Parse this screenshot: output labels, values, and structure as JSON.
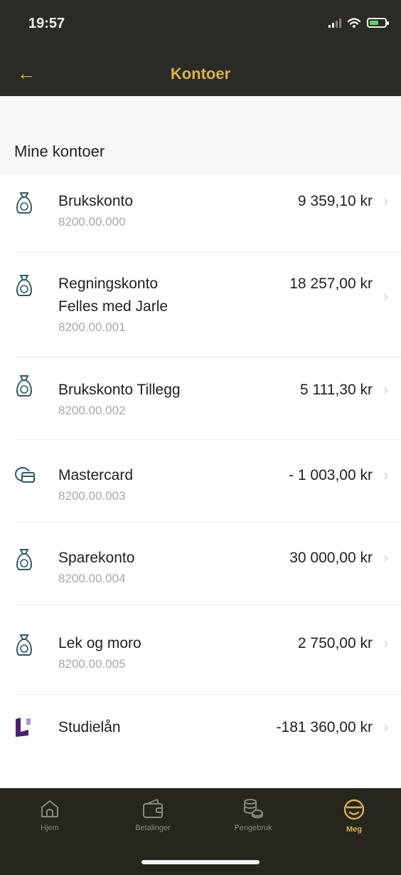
{
  "status_bar": {
    "time": "19:57"
  },
  "header": {
    "title": "Kontoer"
  },
  "section": {
    "title": "Mine kontoer"
  },
  "accounts": [
    {
      "name": "Brukskonto",
      "subname": "",
      "number": "8200.00.000",
      "amount": "9 359,10 kr",
      "icon": "money-bag-icon"
    },
    {
      "name": "Regningskonto",
      "subname": "Felles med Jarle",
      "number": "8200.00.001",
      "amount": "18 257,00 kr",
      "icon": "money-bag-icon"
    },
    {
      "name": "Brukskonto Tillegg",
      "subname": "",
      "number": "8200.00.002",
      "amount": "5 111,30 kr",
      "icon": "money-bag-icon"
    },
    {
      "name": "Mastercard",
      "subname": "",
      "number": "8200.00.003",
      "amount": "- 1 003,00 kr",
      "icon": "credit-card-icon"
    },
    {
      "name": "Sparekonto",
      "subname": "",
      "number": "8200.00.004",
      "amount": "30 000,00 kr",
      "icon": "money-bag-icon"
    },
    {
      "name": "Lek og moro",
      "subname": "",
      "number": "8200.00.005",
      "amount": "2 750,00 kr",
      "icon": "money-bag-icon"
    },
    {
      "name": "Studielån",
      "subname": "",
      "number": "",
      "amount": "-181 360,00 kr",
      "icon": "lanekassen-logo-icon"
    }
  ],
  "tabs": [
    {
      "label": "Hjem",
      "icon": "home-icon"
    },
    {
      "label": "Betalinger",
      "icon": "wallet-icon"
    },
    {
      "label": "Pengebruk",
      "icon": "coins-icon"
    },
    {
      "label": "Meg",
      "icon": "smiley-icon",
      "active": true
    }
  ],
  "colors": {
    "header_bg": "#2a2a26",
    "accent_gold": "#d9b24a",
    "tabbar_bg": "#26261f",
    "icon_teal": "#2e5a64",
    "lanekassen_purple": "#4b1f6f"
  }
}
